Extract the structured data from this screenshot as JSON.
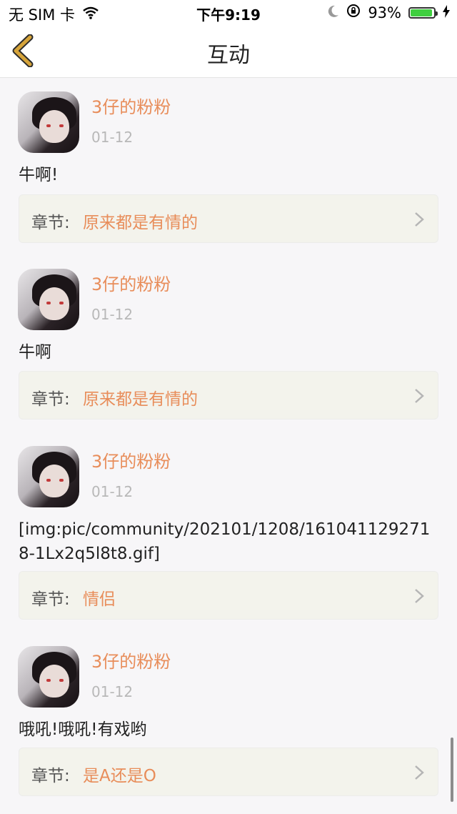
{
  "status_bar": {
    "carrier": "无 SIM 卡",
    "time": "下午9:19",
    "battery_percent": "93%",
    "battery_level": 0.93
  },
  "nav": {
    "title": "互动",
    "back_icon": "chevron-left-icon"
  },
  "chapter_prefix": "章节:",
  "comments": [
    {
      "user": "3仔的粉粉",
      "date": "01-12",
      "text": "牛啊!",
      "chapter": "原来都是有情的"
    },
    {
      "user": "3仔的粉粉",
      "date": "01-12",
      "text": "牛啊",
      "chapter": "原来都是有情的"
    },
    {
      "user": "3仔的粉粉",
      "date": "01-12",
      "text": "[img:pic/community/202101/1208/1610411292718-1Lx2q5l8t8.gif]",
      "chapter": "情侣"
    },
    {
      "user": "3仔的粉粉",
      "date": "01-12",
      "text": "哦吼!哦吼!有戏哟",
      "chapter": "是A还是O"
    }
  ],
  "colors": {
    "accent": "#e88d5a",
    "date": "#b8b8b8",
    "back_arrow": "#d6a43a"
  }
}
